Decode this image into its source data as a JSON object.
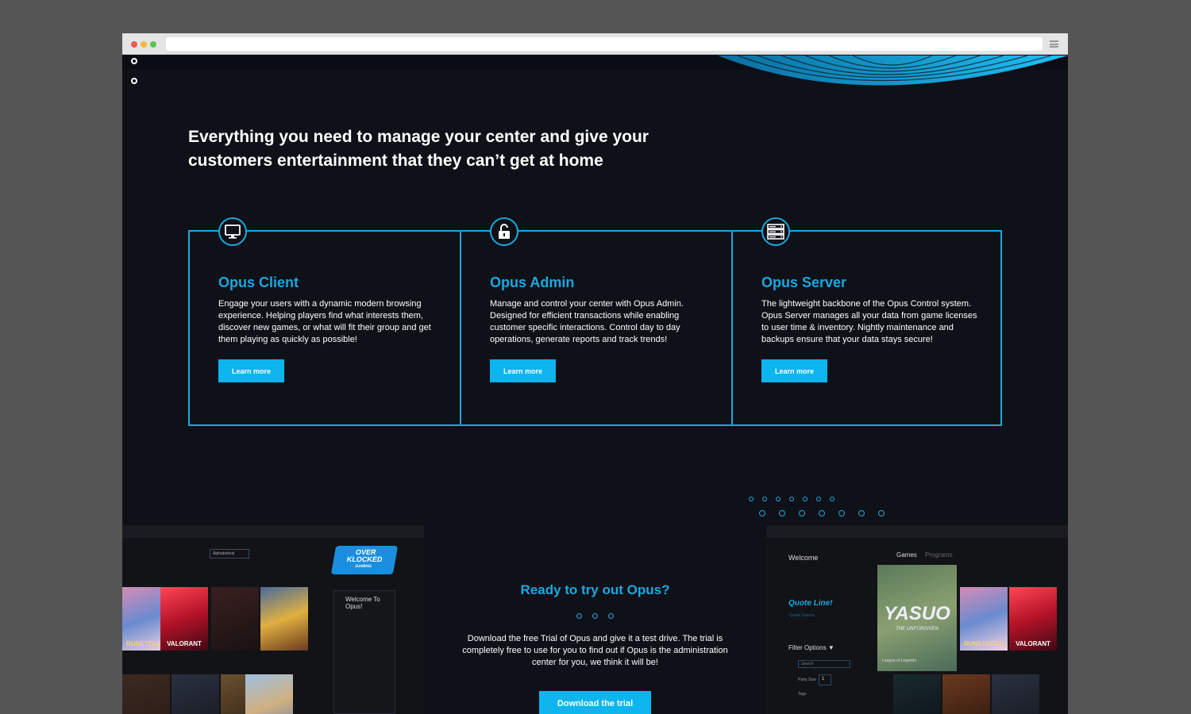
{
  "headline": "Everything you need to manage your center and give your customers entertainment that they can’t get at home",
  "features": [
    {
      "icon": "monitor-icon",
      "title": "Opus Client",
      "text": "Engage your users with a dynamic modern browsing experience. Helping players find what interests them, discover new games, or what will fit their group and get them playing as quickly as possible!",
      "button": "Learn more"
    },
    {
      "icon": "unlock-icon",
      "title": "Opus Admin",
      "text": "Manage and control your center with Opus Admin. Designed for efficient transactions while enabling customer specific interactions. Control day to day operations, generate reports and track trends!",
      "button": "Learn more"
    },
    {
      "icon": "server-icon",
      "title": "Opus Server",
      "text": "The lightweight backbone of the Opus Control system. Opus Server manages all your data from game licenses to user time & inventory. Nightly maintenance and backups ensure that your data stays secure!",
      "button": "Learn more"
    }
  ],
  "cta": {
    "title": "Ready to try out Opus?",
    "text": "Download the free Trial of Opus and give it a test drive. The trial is completely free to use for you to find out if Opus is the administration center for you, we think it will be!",
    "button": "Download the trial"
  },
  "left_screenshot": {
    "sort_label": "Alphabetical",
    "logo_text_line1": "OVER",
    "logo_text_line2": "KLOCKED",
    "logo_text_line3": "GAMING",
    "welcome_title": "Welcome To Opus!",
    "game_label_1": "RUNETERRA",
    "game_label_2": "VALORANT"
  },
  "right_screenshot": {
    "welcome": "Welcome",
    "tab_games": "Games",
    "tab_programs": "Programs",
    "quote": "Quote Line!",
    "quote_source": "-Quote Source",
    "filter": "Filter Options",
    "featured_game": "YASUO",
    "featured_sub": "THE UNFORGIVEN",
    "featured_caption": "League of Legends",
    "party_size_label": "Party Size",
    "party_size_value": "1",
    "tags_label": "Tags",
    "search_placeholder": "Search",
    "game_label_1": "RUNETERRA",
    "game_label_2": "VALORANT"
  },
  "colors": {
    "accent": "#1da7df",
    "button": "#0cb5ee",
    "background": "#0f1118"
  }
}
